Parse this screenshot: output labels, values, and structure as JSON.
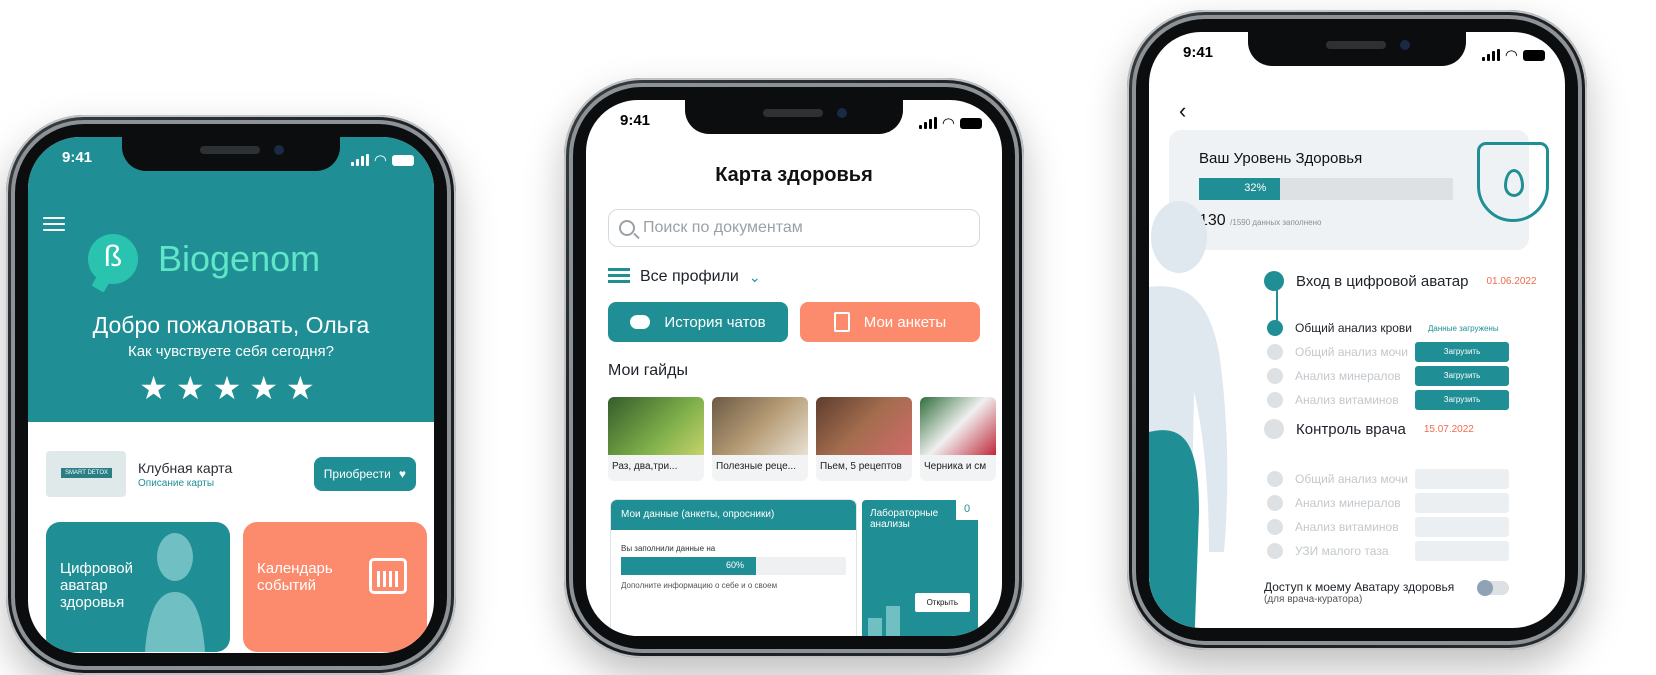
{
  "status_time": "9:41",
  "phone1": {
    "brand": "Biogenom",
    "welcome": "Добро пожаловать, Ольга",
    "question": "Как чувствуете себя сегодня?",
    "stars": "★★★★★",
    "club_card_label": "SMART DETOX",
    "club_title": "Клубная карта",
    "club_sub": "Описание карты",
    "buy_label": "Приобрести",
    "tile_avatar": "Цифровой аватар здоровья",
    "tile_calendar": "Календарь событий",
    "accent": "#1f8f95",
    "coral": "#fb8b6c"
  },
  "phone2": {
    "title": "Карта здоровья",
    "search_placeholder": "Поиск по документам",
    "profiles": "Все профили",
    "chat_history": "История чатов",
    "my_forms": "Мои анкеты",
    "guides_title": "Мои гайды",
    "guides": [
      "Раз, два,три...",
      "Полезные реце...",
      "Пьем, 5 рецептов",
      "Черника и см"
    ],
    "data_title": "Мои данные (анкеты, опросники)",
    "data_filled_label": "Вы заполнили данные на",
    "data_percent": "60%",
    "data_fill": 0.6,
    "data_more": "Дополните информацию о себе и о своем",
    "lab_title": "Лабораторные анализы",
    "lab_count": "0",
    "lab_open": "Открыть"
  },
  "phone3": {
    "level_title": "Ваш Уровень Здоровья",
    "level_percent": "32%",
    "level_fill": 0.32,
    "filled_count": "130",
    "filled_suffix": "/1590 данных заполнено",
    "step1_title": "Вход в цифровой аватар",
    "step1_date": "01.06.2022",
    "step2_title": "Контроль врача",
    "step2_date": "15.07.2022",
    "loaded_label": "Данные загружены",
    "upload_label": "Загрузить",
    "tests1": [
      "Общий анализ крови",
      "Общий анализ мочи",
      "Анализ минералов",
      "Анализ витаминов"
    ],
    "tests2": [
      "Общий анализ мочи",
      "Анализ минералов",
      "Анализ витаминов",
      "УЗИ малого таза"
    ],
    "access_label": "Доступ к моему Аватару здоровья",
    "access_sub": "(для врача-куратора)"
  }
}
